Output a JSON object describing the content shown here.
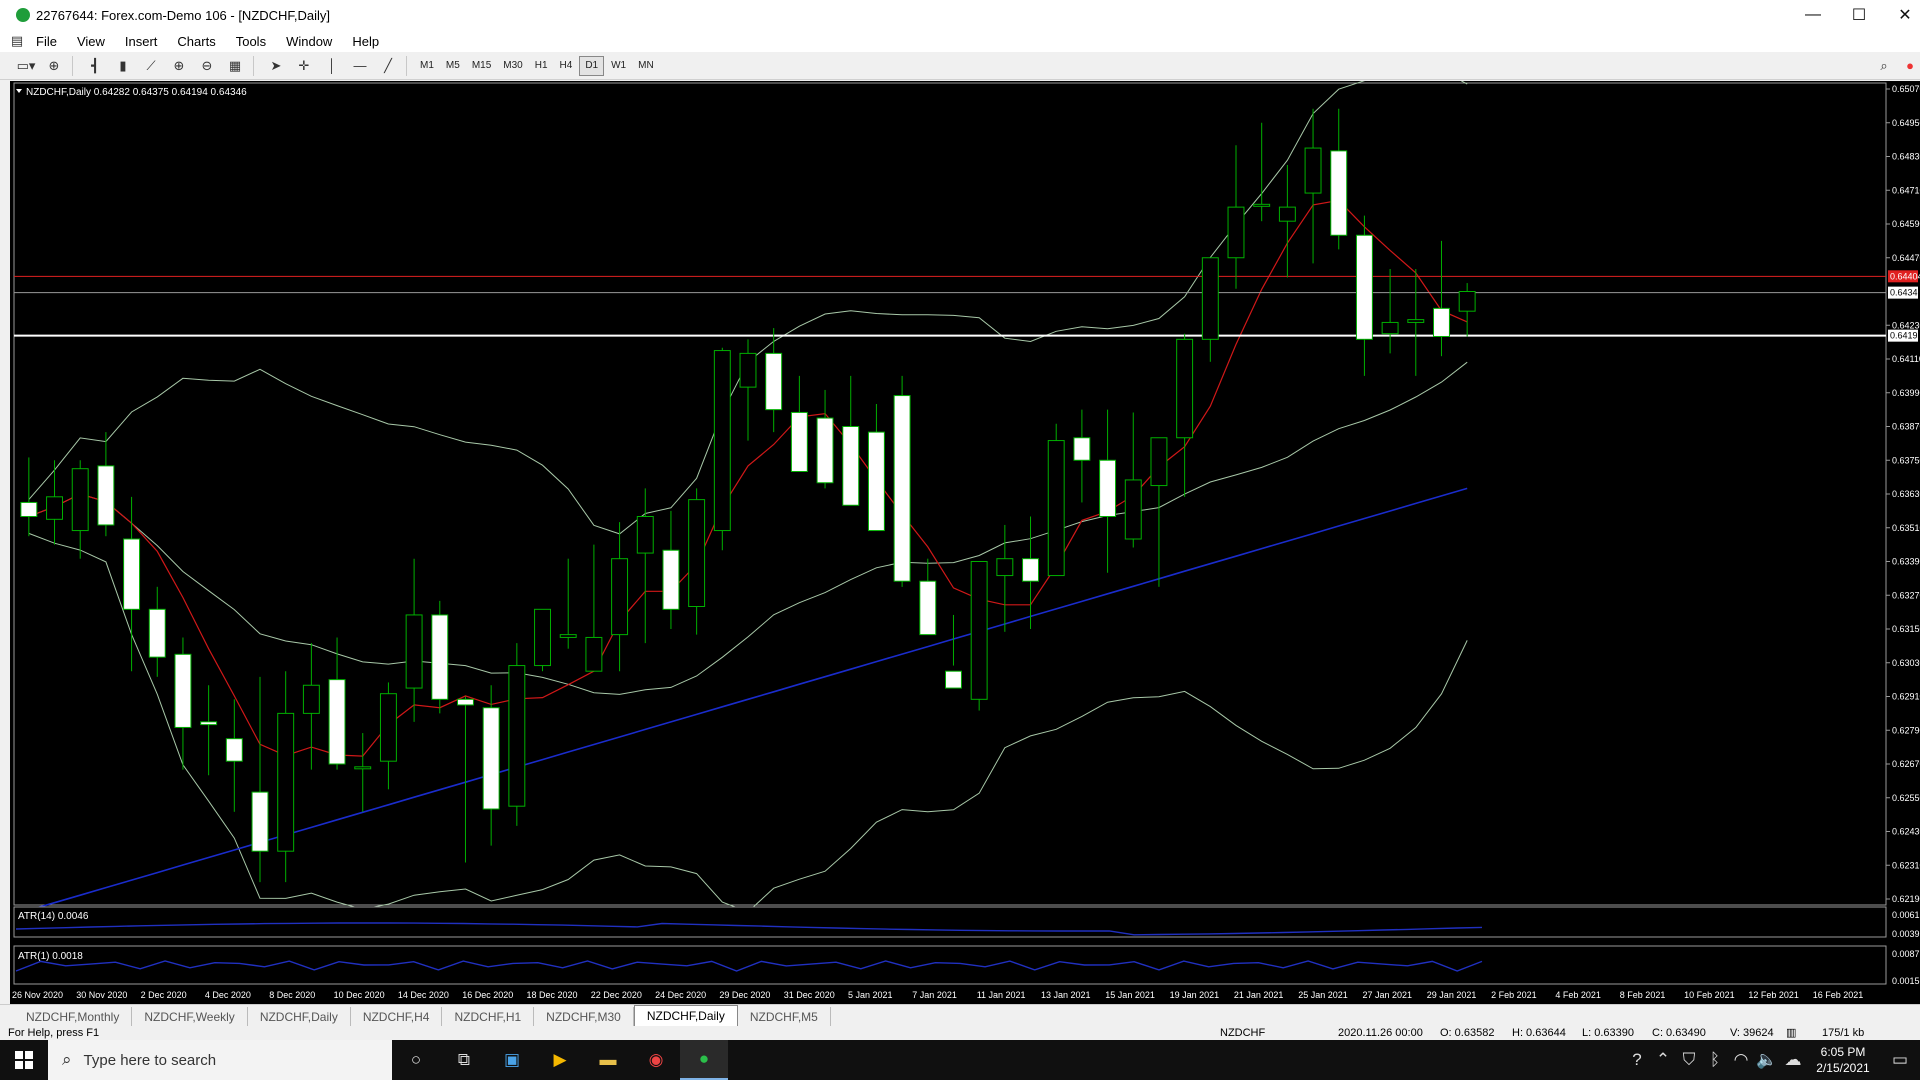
{
  "window": {
    "title": "22767644: Forex.com-Demo 106 - [NZDCHF,Daily]",
    "minimize": "—",
    "maximize": "☐",
    "close": "✕"
  },
  "menu": [
    "File",
    "View",
    "Insert",
    "Charts",
    "Tools",
    "Window",
    "Help"
  ],
  "toolbar": {
    "timeframes": [
      "M1",
      "M5",
      "M15",
      "M30",
      "H1",
      "H4",
      "D1",
      "W1",
      "MN"
    ],
    "active_timeframe": "D1"
  },
  "chart": {
    "info_label": "NZDCHF,Daily  0.64282 0.64375 0.64194 0.64346",
    "bid_tag": "0.64346",
    "ask_tag": "0.64404",
    "hline_tag": "0.64193",
    "price_axis": [
      "0.65070",
      "0.64950",
      "0.64830",
      "0.64710",
      "0.64590",
      "0.64470",
      "0.64230",
      "0.64110",
      "0.63990",
      "0.63870",
      "0.63750",
      "0.63630",
      "0.63510",
      "0.63390",
      "0.63270",
      "0.63150",
      "0.63030",
      "0.62910",
      "0.62790",
      "0.62670",
      "0.62550",
      "0.62430",
      "0.62310",
      "0.62190"
    ],
    "date_axis": [
      "26 Nov 2020",
      "30 Nov 2020",
      "2 Dec 2020",
      "4 Dec 2020",
      "8 Dec 2020",
      "10 Dec 2020",
      "14 Dec 2020",
      "16 Dec 2020",
      "18 Dec 2020",
      "22 Dec 2020",
      "24 Dec 2020",
      "29 Dec 2020",
      "31 Dec 2020",
      "5 Jan 2021",
      "7 Jan 2021",
      "11 Jan 2021",
      "13 Jan 2021",
      "15 Jan 2021",
      "19 Jan 2021",
      "21 Jan 2021",
      "25 Jan 2021",
      "27 Jan 2021",
      "29 Jan 2021",
      "2 Feb 2021",
      "4 Feb 2021",
      "8 Feb 2021",
      "10 Feb 2021",
      "12 Feb 2021",
      "16 Feb 2021"
    ],
    "atr14": {
      "label": "ATR(14) 0.0046",
      "axis": [
        "0.0061",
        "0.0039"
      ]
    },
    "atr1": {
      "label": "ATR(1) 0.0018",
      "axis": [
        "0.0087",
        "0.0015"
      ]
    },
    "colors": {
      "background": "#000000",
      "candle_bull_fill": "#000000",
      "candle_bear_fill": "#ffffff",
      "candle_outline": "#00b000",
      "ma_fast": "#d01818",
      "ma_slow": "#1a2ccc",
      "bands": "#a8c8a8",
      "ask_line": "#e02020"
    }
  },
  "chart_data": {
    "type": "candlestick",
    "symbol": "NZDCHF",
    "timeframe": "Daily",
    "ohlc": [
      [
        0.636,
        0.6376,
        0.6348,
        0.6355
      ],
      [
        0.6354,
        0.6375,
        0.6345,
        0.6362
      ],
      [
        0.635,
        0.6375,
        0.634,
        0.6372
      ],
      [
        0.6373,
        0.6385,
        0.6348,
        0.6352
      ],
      [
        0.6347,
        0.6362,
        0.63,
        0.6322
      ],
      [
        0.6322,
        0.633,
        0.6298,
        0.6305
      ],
      [
        0.6306,
        0.6312,
        0.6265,
        0.628
      ],
      [
        0.6282,
        0.6295,
        0.6263,
        0.6281
      ],
      [
        0.6276,
        0.629,
        0.625,
        0.6268
      ],
      [
        0.6257,
        0.6298,
        0.6225,
        0.6236
      ],
      [
        0.6236,
        0.63,
        0.6225,
        0.6285
      ],
      [
        0.6285,
        0.631,
        0.6265,
        0.6295
      ],
      [
        0.6297,
        0.6312,
        0.6265,
        0.6267
      ],
      [
        0.6266,
        0.6278,
        0.625,
        0.6266
      ],
      [
        0.6268,
        0.6296,
        0.6258,
        0.6292
      ],
      [
        0.6294,
        0.634,
        0.6282,
        0.632
      ],
      [
        0.632,
        0.6325,
        0.6285,
        0.629
      ],
      [
        0.629,
        0.6291,
        0.6232,
        0.6288
      ],
      [
        0.6287,
        0.6295,
        0.6238,
        0.6251
      ],
      [
        0.6252,
        0.631,
        0.6245,
        0.6302
      ],
      [
        0.6302,
        0.632,
        0.63,
        0.6322
      ],
      [
        0.6312,
        0.634,
        0.6308,
        0.6313
      ],
      [
        0.63,
        0.6345,
        0.63,
        0.6312
      ],
      [
        0.6313,
        0.6353,
        0.63,
        0.634
      ],
      [
        0.6342,
        0.6365,
        0.631,
        0.6355
      ],
      [
        0.6343,
        0.6357,
        0.6315,
        0.6322
      ],
      [
        0.6323,
        0.6365,
        0.6313,
        0.6361
      ],
      [
        0.635,
        0.6415,
        0.6343,
        0.6414
      ],
      [
        0.6401,
        0.6418,
        0.6382,
        0.6413
      ],
      [
        0.6413,
        0.6422,
        0.6385,
        0.6393
      ],
      [
        0.6392,
        0.6405,
        0.6375,
        0.6371
      ],
      [
        0.639,
        0.64,
        0.6365,
        0.6367
      ],
      [
        0.6387,
        0.6405,
        0.6365,
        0.6359
      ],
      [
        0.6385,
        0.6395,
        0.6352,
        0.635
      ],
      [
        0.6398,
        0.6405,
        0.633,
        0.6332
      ],
      [
        0.6332,
        0.634,
        0.632,
        0.6313
      ],
      [
        0.63,
        0.632,
        0.6302,
        0.6294
      ],
      [
        0.629,
        0.633,
        0.6286,
        0.6339
      ],
      [
        0.6334,
        0.6352,
        0.6314,
        0.634
      ],
      [
        0.634,
        0.6355,
        0.6315,
        0.6332
      ],
      [
        0.6334,
        0.6388,
        0.6334,
        0.6382
      ],
      [
        0.6383,
        0.6393,
        0.636,
        0.6375
      ],
      [
        0.6375,
        0.6393,
        0.6335,
        0.6355
      ],
      [
        0.6347,
        0.6392,
        0.6344,
        0.6368
      ],
      [
        0.6366,
        0.6375,
        0.633,
        0.6383
      ],
      [
        0.6383,
        0.642,
        0.6362,
        0.6418
      ],
      [
        0.6418,
        0.6445,
        0.641,
        0.6447
      ],
      [
        0.6447,
        0.6487,
        0.6436,
        0.6465
      ],
      [
        0.6466,
        0.6495,
        0.646,
        0.6466
      ],
      [
        0.646,
        0.648,
        0.644,
        0.6465
      ],
      [
        0.647,
        0.65,
        0.6445,
        0.6486
      ],
      [
        0.6485,
        0.65,
        0.645,
        0.6455
      ],
      [
        0.6455,
        0.6462,
        0.6405,
        0.6418
      ],
      [
        0.642,
        0.6443,
        0.6413,
        0.6424
      ],
      [
        0.6424,
        0.6443,
        0.6405,
        0.6425
      ],
      [
        0.6429,
        0.6453,
        0.6412,
        0.6419
      ],
      [
        0.6428,
        0.6438,
        0.6419,
        0.6435
      ]
    ],
    "ylim": [
      0.6219,
      0.6507
    ]
  }
}
